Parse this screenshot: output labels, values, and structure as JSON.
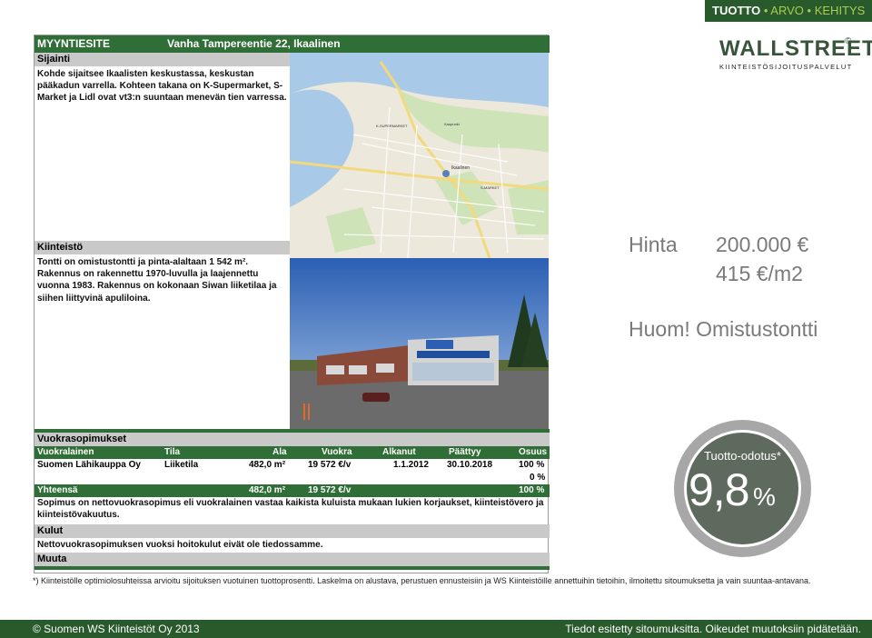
{
  "topbar": {
    "tuotto": "TUOTTO",
    "sep1": "•",
    "arvo": "ARVO",
    "sep2": "•",
    "kehitys": "KEHITYS"
  },
  "logo": {
    "main": "WALLSTREET",
    "sub": "KIINTEISTÖSIJOITUSPALVELUT",
    "reg": "©"
  },
  "document": {
    "header_left": "MYYNTIESITE",
    "header_right": "Vanha Tampereentie 22, Ikaalinen",
    "sijainti_title": "Sijainti",
    "sijainti_text": "Kohde sijaitsee Ikaalisten keskustassa, keskustan pääkadun varrella. Kohteen takana on K-Supermarket, S-Market ja Lidl ovat vt3:n suuntaan menevän tien varressa.",
    "kiinteisto_title": "Kiinteistö",
    "kiinteisto_text": "Tontti on omistustontti ja pinta-alaltaan 1 542 m². Rakennus on rakennettu 1970-luvulla ja laajennettu vuonna 1983. Rakennus on kokonaan Siwan liiketilaa ja siihen liittyvinä apuliloina.",
    "vuokra_title": "Vuokrasopimukset",
    "columns": [
      "Vuokralainen",
      "Tila",
      "Ala",
      "Vuokra",
      "Alkanut",
      "Päättyy",
      "Osuus"
    ],
    "row": [
      "Suomen Lähikauppa Oy",
      "Liiketila",
      "482,0 m²",
      "19 572 €/v",
      "1.1.2012",
      "30.10.2018",
      "100 %"
    ],
    "empty_pct": "0 %",
    "total": [
      "Yhteensä",
      "482,0 m²",
      "19 572 €/v",
      "100 %"
    ],
    "sopimus_text": "Sopimus on nettovuokrasopimus eli vuokralainen vastaa kaikista kuluista mukaan lukien korjaukset, kiinteistövero ja kiinteistövakuutus.",
    "kulut_title": "Kulut",
    "kulut_text": "Nettovuokrasopimuksen vuoksi hoitokulut eivät ole tiedossamme.",
    "muuta_title": "Muuta",
    "map_labels": [
      "Ikaalinen",
      "S-MARKET",
      "K-SUPERMARKET",
      "Kaupunki"
    ]
  },
  "price": {
    "label": "Hinta",
    "value": "200.000 €",
    "per_m2": "415 €/m2"
  },
  "note": "Huom! Omistustontti",
  "yield": {
    "label": "Tuotto-odotus*",
    "big": "9,8",
    "pct": "%"
  },
  "footnote": "*) Kiinteistölle optimiolosuhteissa arvioitu sijoituksen vuotuinen tuottoprosentti. Laskelma on alustava, perustuen ennusteisiin ja WS Kiinteistöille annettuihin tietoihin, ilmoitettu sitoumuksetta ja vain suuntaa-antavana.",
  "footer": {
    "left": "© Suomen WS Kiinteistöt Oy 2013",
    "right": "Tiedot esitetty sitoumuksitta. Oikeudet muutoksiin pidätetään."
  },
  "colors": {
    "brand_green": "#285a2c",
    "doc_green": "#2f6e36",
    "grey_text": "#7a7a7a",
    "circle": "#5f6a5f"
  }
}
